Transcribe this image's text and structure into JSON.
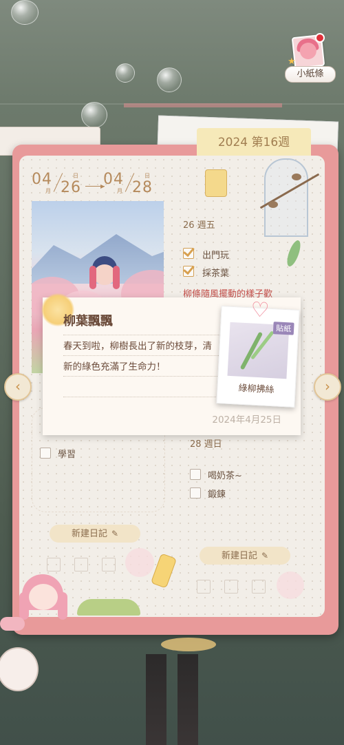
{
  "header": {
    "note_button_label": "小紙條",
    "week_label": "2024 第16週"
  },
  "date_range": {
    "start_month": "04",
    "start_day": "26",
    "end_month": "04",
    "end_day": "28",
    "month_unit": "月",
    "day_unit": "日"
  },
  "days": [
    {
      "title": "26 週五",
      "tasks": [
        {
          "label": "出門玩",
          "done": true
        },
        {
          "label": "採茶葉",
          "done": true
        }
      ],
      "note_snippet": "柳條隨風擺動的樣子歡"
    },
    {
      "tasks": [
        {
          "label": "學習",
          "done": false
        }
      ],
      "new_entry_label": "新建日記"
    },
    {
      "title": "28 週日",
      "tasks": [
        {
          "label": "喝奶茶~",
          "done": false
        },
        {
          "label": "鍛鍊",
          "done": false
        }
      ],
      "new_entry_label": "新建日記"
    }
  ],
  "popup": {
    "title": "柳葉飄飄",
    "body": "春天到啦，柳樹長出了新的枝芽，清新的綠色充滿了生命力！",
    "date": "2024年4月25日"
  },
  "sticker": {
    "badge": "貼紙",
    "name": "綠柳拂絲"
  },
  "navigation": {
    "prev_icon": "chevron-left-icon",
    "next_icon": "chevron-right-icon"
  },
  "colors": {
    "book_cover": "#e89a9a",
    "page": "#f2eee8",
    "accent_gold": "#b58a5c",
    "text_brown": "#6b4b3a"
  }
}
